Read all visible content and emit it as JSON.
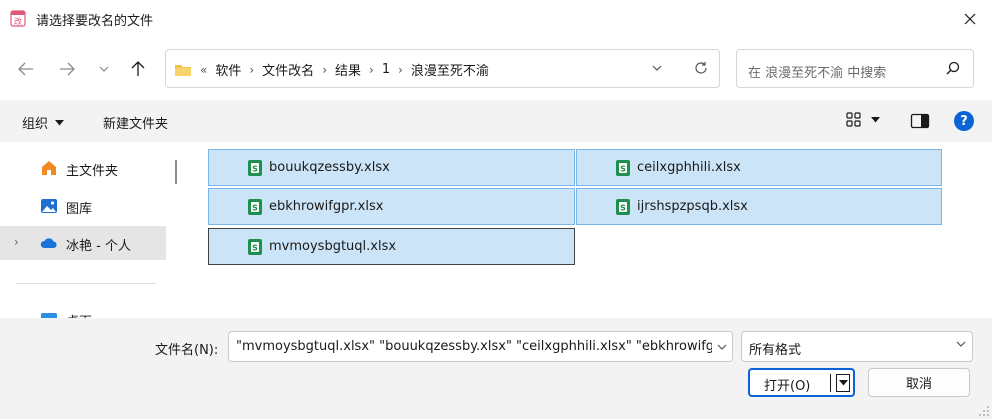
{
  "window": {
    "title": "请选择要改名的文件",
    "icon": "app-rename-icon"
  },
  "nav": {
    "back_icon": "arrow-left-icon",
    "forward_icon": "arrow-right-icon",
    "recent_icon": "chevron-down-icon",
    "up_icon": "arrow-up-icon",
    "overflow": "«",
    "breadcrumbs": [
      "软件",
      "文件改名",
      "结果",
      "1",
      "浪漫至死不渝"
    ],
    "search_placeholder": "在 浪漫至死不渝 中搜索"
  },
  "toolbar": {
    "organize_label": "组织",
    "new_folder_label": "新建文件夹",
    "help_label": "?"
  },
  "sidebar": {
    "items": [
      {
        "label": "主文件夹",
        "icon": "home-icon"
      },
      {
        "label": "图库",
        "icon": "gallery-icon"
      },
      {
        "label": "冰艳 - 个人",
        "icon": "onedrive-cloud-icon"
      },
      {
        "label": "桌面",
        "icon": "desktop-icon"
      }
    ]
  },
  "files": [
    {
      "name": "bouukqzessby.xlsx"
    },
    {
      "name": "ceilxgphhili.xlsx"
    },
    {
      "name": "ebkhrowifgpr.xlsx"
    },
    {
      "name": "ijrshspzpsqb.xlsx"
    },
    {
      "name": "mvmoysbgtuql.xlsx"
    }
  ],
  "bottom": {
    "filename_label": "文件名(N):",
    "filename_value": "\"mvmoysbgtuql.xlsx\" \"bouukqzessby.xlsx\" \"ceilxgphhili.xlsx\" \"ebkhrowifgpr.xlsx\" \"ijrshspzpsqb.xlsx\"",
    "filetype_value": "所有格式",
    "open_label": "打开(O)",
    "cancel_label": "取消"
  },
  "colors": {
    "accent": "#0a64d6",
    "selection_bg": "#cce4f7",
    "selection_border": "#7cb5e8",
    "excel_green": "#1d8f4e",
    "folder_yellow": "#f2c14e"
  }
}
